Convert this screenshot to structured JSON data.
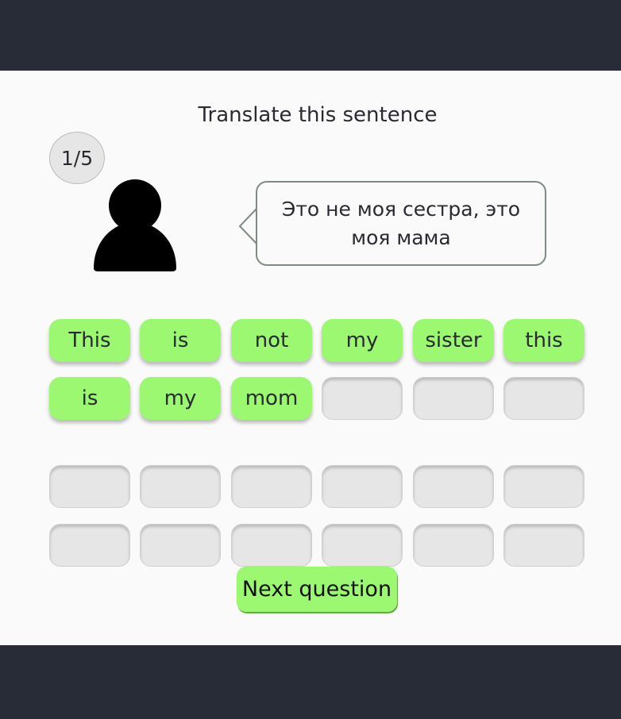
{
  "header": {
    "title": "Translate this sentence"
  },
  "progress": {
    "label": "1/5",
    "current": 1,
    "total": 5
  },
  "speaker": {
    "icon": "person-icon",
    "sentence": "Это не моя сестра, это моя мама"
  },
  "answer_slots": [
    "This",
    "is",
    "not",
    "my",
    "sister",
    "this",
    "is",
    "my",
    "mom",
    "",
    "",
    ""
  ],
  "word_bank": [
    "",
    "",
    "",
    "",
    "",
    "",
    "",
    "",
    "",
    "",
    "",
    ""
  ],
  "next_button": {
    "label": "Next question"
  },
  "colors": {
    "accent": "#9bf870",
    "background": "#fafafa",
    "frame": "#282c36",
    "slot_empty": "#e6e6e6",
    "bubble_border": "#7c8c80"
  }
}
